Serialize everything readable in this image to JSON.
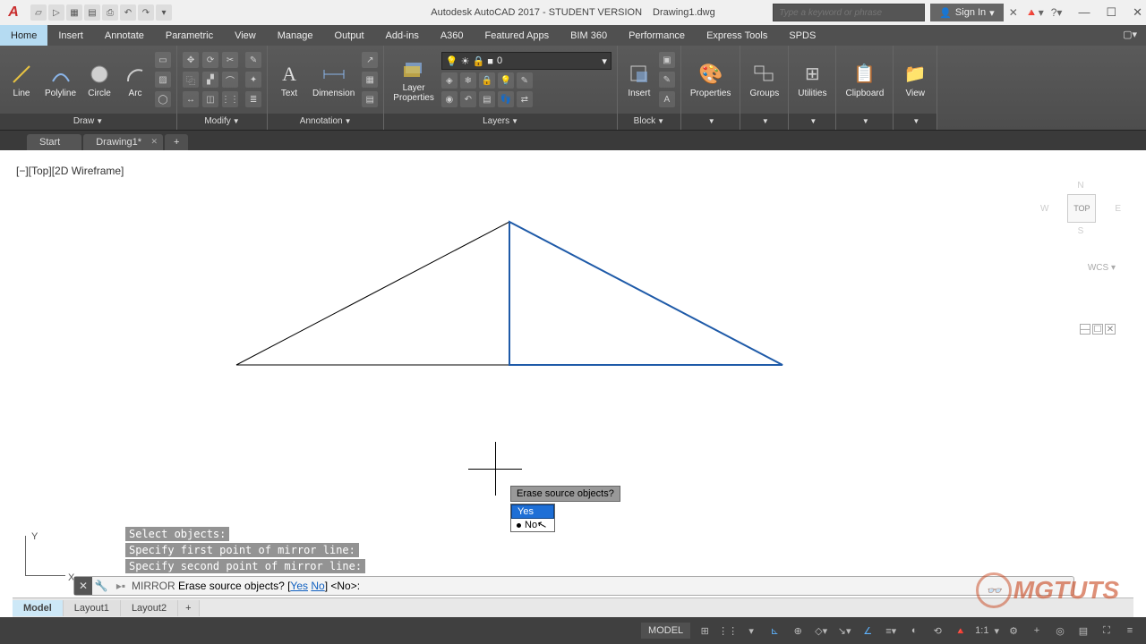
{
  "title": {
    "app": "Autodesk AutoCAD 2017 - STUDENT VERSION",
    "doc": "Drawing1.dwg"
  },
  "search": {
    "placeholder": "Type a keyword or phrase"
  },
  "signin": {
    "label": "Sign In"
  },
  "menu": {
    "tabs": [
      "Home",
      "Insert",
      "Annotate",
      "Parametric",
      "View",
      "Manage",
      "Output",
      "Add-ins",
      "A360",
      "Featured Apps",
      "BIM 360",
      "Performance",
      "Express Tools",
      "SPDS"
    ]
  },
  "ribbon": {
    "draw": {
      "title": "Draw",
      "line": "Line",
      "polyline": "Polyline",
      "circle": "Circle",
      "arc": "Arc"
    },
    "modify": {
      "title": "Modify"
    },
    "annotation": {
      "title": "Annotation",
      "text": "Text",
      "dimension": "Dimension"
    },
    "layers": {
      "title": "Layers",
      "properties": "Layer\nProperties",
      "current": "0"
    },
    "block": {
      "title": "Block",
      "insert": "Insert"
    },
    "properties": {
      "title": "Properties"
    },
    "groups": {
      "title": "Groups"
    },
    "utilities": {
      "title": "Utilities"
    },
    "clipboard": {
      "title": "Clipboard"
    },
    "view": {
      "title": "View"
    }
  },
  "filetabs": {
    "start": "Start",
    "active": "Drawing1*"
  },
  "viewport": {
    "label": "[−][Top][2D Wireframe]"
  },
  "viewcube": {
    "n": "N",
    "s": "S",
    "e": "E",
    "w": "W",
    "top": "TOP",
    "wcs": "WCS ▾"
  },
  "prompt": {
    "question": "Erase source objects?",
    "yes": "Yes",
    "no": "No"
  },
  "ucs": {
    "y": "Y",
    "x": "X"
  },
  "history": {
    "l1": "Select objects:",
    "l2": "Specify first point of mirror line:",
    "l3": "Specify second point of mirror line:"
  },
  "cmdline": {
    "cmd": "MIRROR",
    "text": "Erase source objects? [",
    "yes": "Yes",
    "no": "No",
    "tail": "] <No>:"
  },
  "layouts": {
    "model": "Model",
    "l1": "Layout1",
    "l2": "Layout2"
  },
  "status": {
    "model": "MODEL",
    "scale": "1:1"
  },
  "watermark": {
    "text": "MGTUTS"
  }
}
